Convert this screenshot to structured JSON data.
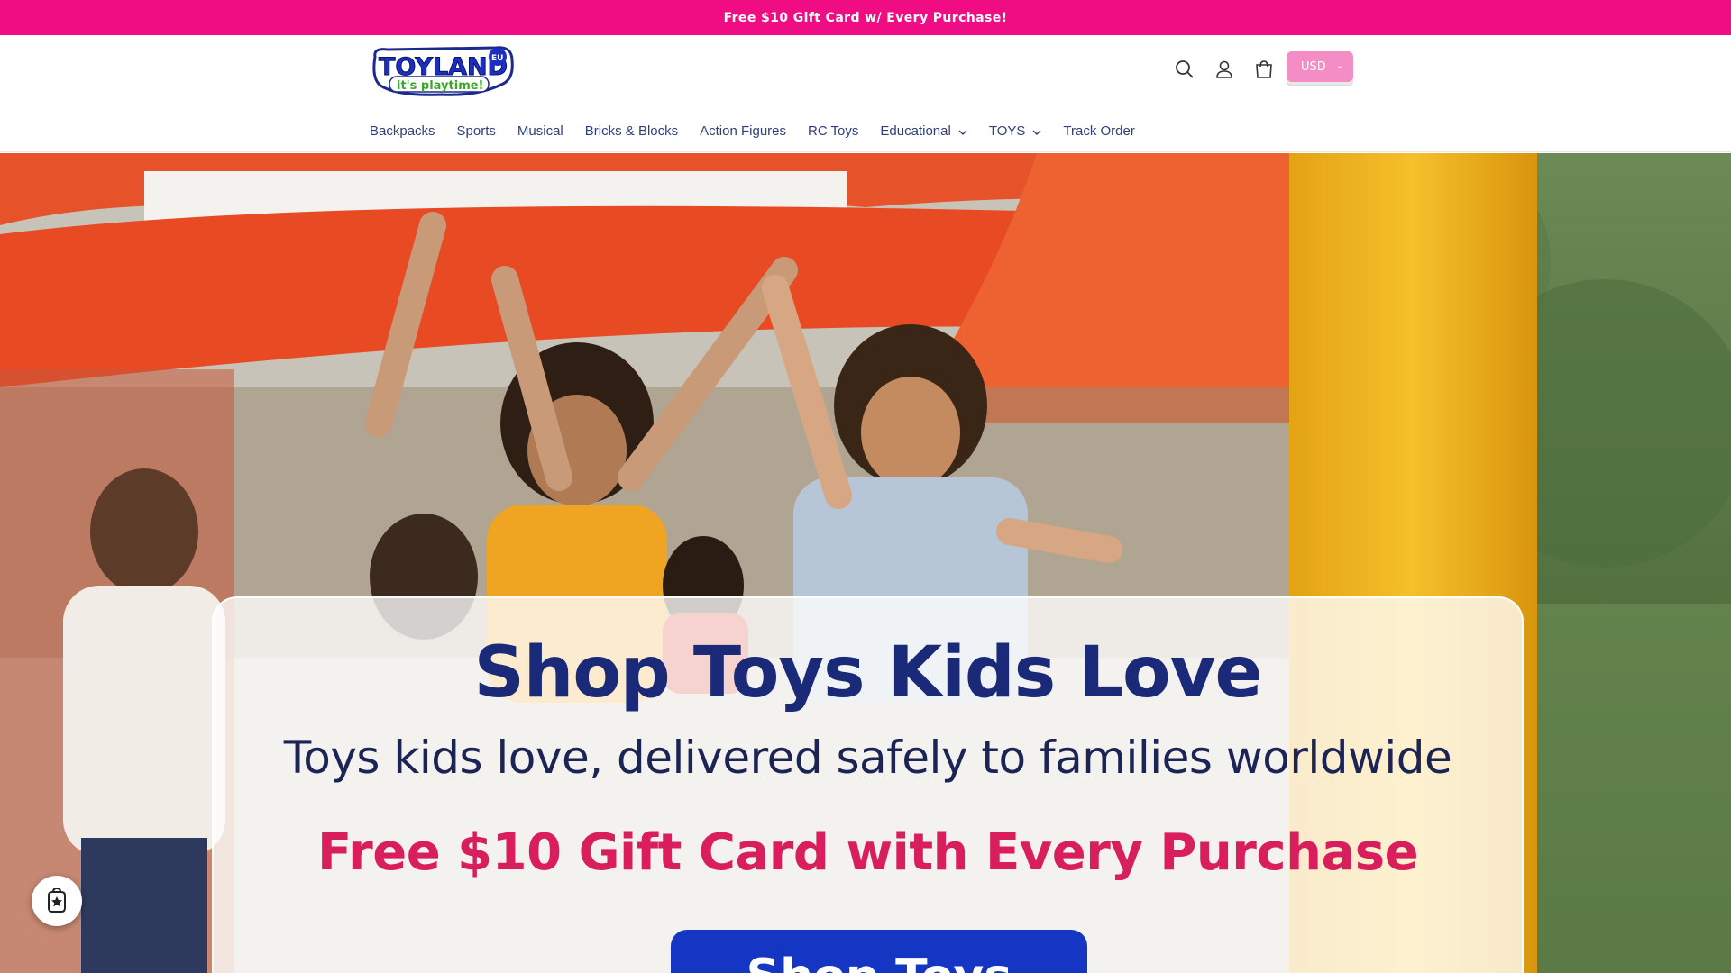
{
  "announcement": {
    "text": "Free $10 Gift Card w/ Every Purchase!"
  },
  "header": {
    "logo": {
      "brand": "TOYLAND",
      "tagline": "it's playtime!",
      "region": "EU"
    },
    "icons": [
      "search-icon",
      "account-icon",
      "cart-icon"
    ],
    "currency": {
      "selected": "USD"
    }
  },
  "nav": {
    "items": [
      {
        "label": "Backpacks"
      },
      {
        "label": "Sports"
      },
      {
        "label": "Musical"
      },
      {
        "label": "Bricks & Blocks"
      },
      {
        "label": "Action Figures"
      },
      {
        "label": "RC Toys"
      },
      {
        "label": "Educational",
        "dropdown": true
      },
      {
        "label": "TOYS",
        "dropdown": true
      },
      {
        "label": "Track Order"
      }
    ]
  },
  "hero": {
    "title": "Shop Toys Kids Love",
    "subtitle": "Toys kids love, delivered safely to families worldwide",
    "promo": "Free $10 Gift Card with Every Purchase",
    "cta": "Shop Toys"
  },
  "colors": {
    "announcement_bg": "#f00d83",
    "nav_text": "#2f3f78",
    "title": "#1a2a78",
    "promo": "#d81e5d",
    "cta_bg": "#1436c2",
    "currency_bg": "#f48cc6"
  },
  "widgets": {
    "review_badge": "shield-star-icon"
  }
}
